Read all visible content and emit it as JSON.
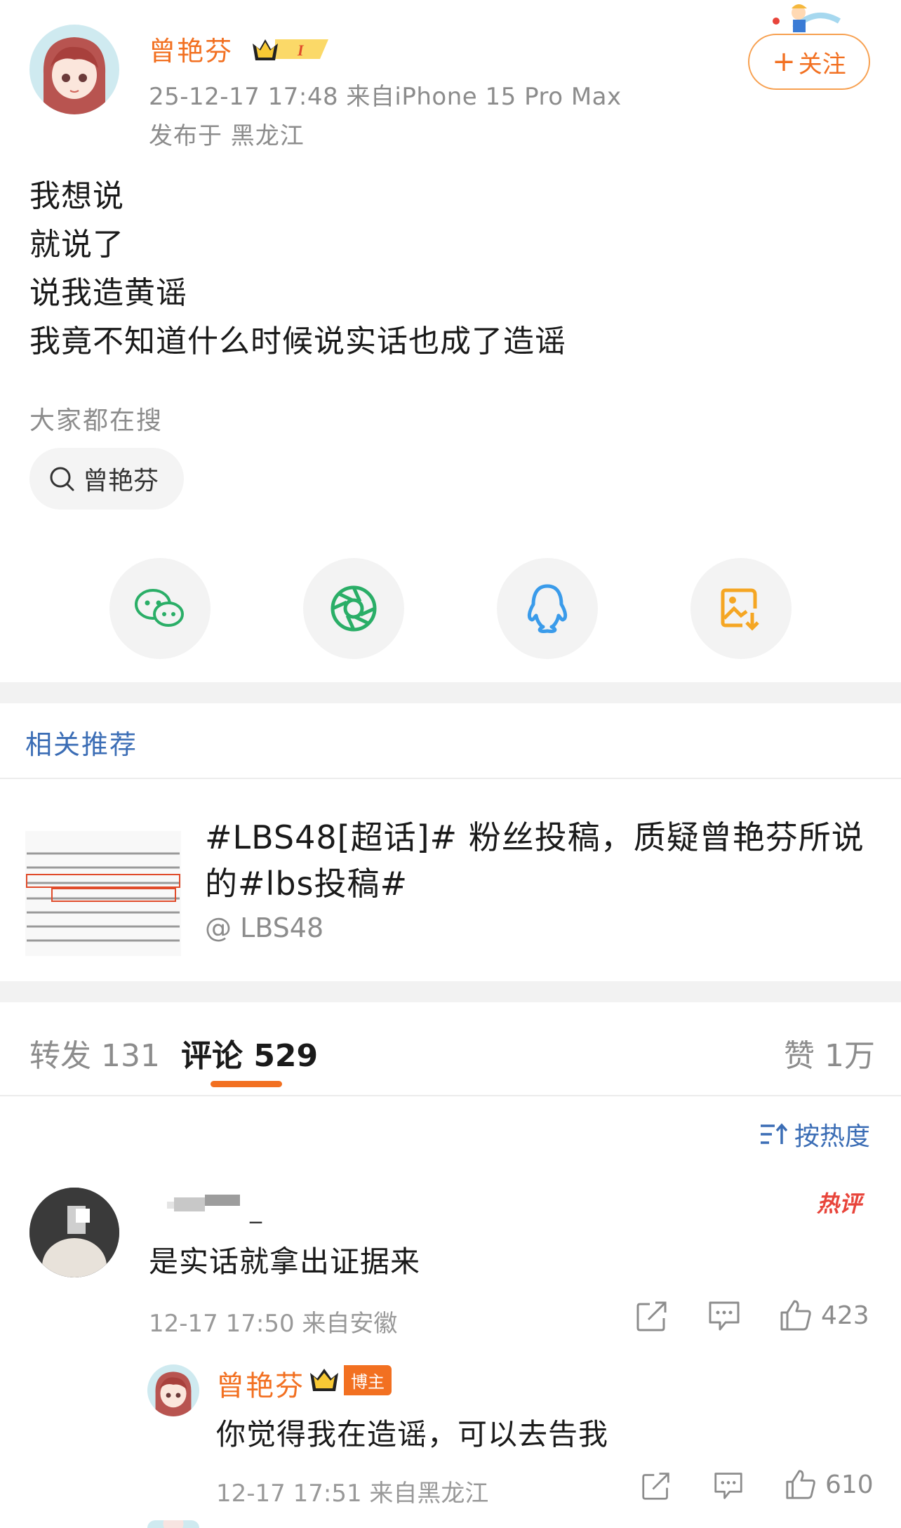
{
  "post": {
    "author": "曾艳芬",
    "level_badge": "I",
    "meta": "25-12-17 17:48  来自iPhone 15 Pro Max",
    "location": "发布于 黑龙江",
    "follow_label": "关注",
    "lines": [
      "我想说",
      "就说了",
      "说我造黄谣",
      "我竟不知道什么时候说实话也成了造谣"
    ]
  },
  "search": {
    "title": "大家都在搜",
    "chip": "曾艳芬"
  },
  "share": [
    "wechat-icon",
    "moments-icon",
    "qq-icon",
    "save-image-icon"
  ],
  "related": {
    "title": "相关推荐",
    "item_title": "#LBS48[超话]# 粉丝投稿，质疑曾艳芬所说的#lbs投稿#",
    "item_author": "@ LBS48"
  },
  "tabs": {
    "repost": "转发 131",
    "comments": "评论 529",
    "likes": "赞 1万"
  },
  "sort_label": "按热度",
  "comments": [
    {
      "name": "_",
      "hot": "热评",
      "text": "是实话就拿出证据来",
      "meta": "12-17 17:50 来自安徽",
      "likes": "423"
    }
  ],
  "reply": {
    "name": "曾艳芬",
    "badge": "博主",
    "text": "你觉得我在造谣，可以去告我",
    "meta": "12-17 17:51 来自黑龙江",
    "likes": "610"
  },
  "colors": {
    "accent": "#f27021",
    "link": "#3b6db5",
    "wechat": "#2aae67",
    "moments": "#2aae67",
    "qq": "#3a9bea",
    "save": "#f5a623"
  }
}
